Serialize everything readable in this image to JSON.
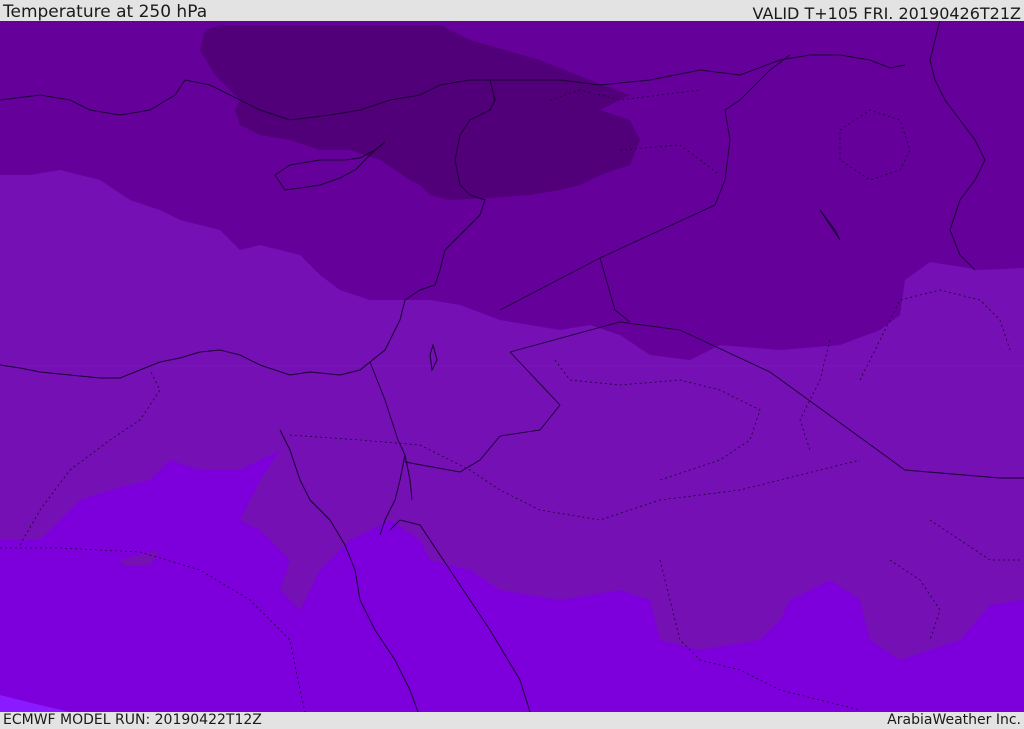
{
  "header": {
    "title": "Temperature at 250 hPa",
    "valid": "VALID T+105 FRI. 20190426T21Z"
  },
  "footer": {
    "model_run": "ECMWF MODEL RUN: 20190422T12Z",
    "credit": "ArabiaWeather Inc."
  },
  "colors": {
    "darkest_band": "#52007a",
    "dark_band": "#65009b",
    "mid_band": "#7510b4",
    "light_band": "#7d00dc",
    "lightest_band": "#8a1aff",
    "coastline": "#1a0033"
  }
}
